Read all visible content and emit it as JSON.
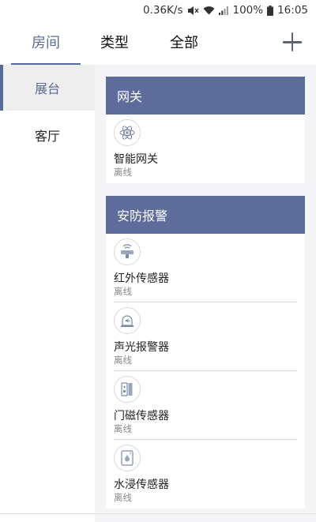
{
  "status_bar": {
    "speed": "0.36K/s",
    "battery": "100%",
    "time": "16:05",
    "icons": [
      "mute-icon",
      "wifi-icon",
      "signal-icon",
      "battery-icon"
    ]
  },
  "tabs": [
    {
      "label": "房间",
      "active": true
    },
    {
      "label": "类型",
      "active": false
    },
    {
      "label": "全部",
      "active": false
    }
  ],
  "add_icon": "plus-icon",
  "sidebar": {
    "items": [
      {
        "label": "展台",
        "active": true
      },
      {
        "label": "客厅",
        "active": false
      }
    ]
  },
  "groups": [
    {
      "title": "网关",
      "devices": [
        {
          "name": "智能网关",
          "status": "离线",
          "icon": "gateway-icon"
        }
      ]
    },
    {
      "title": "安防报警",
      "devices": [
        {
          "name": "红外传感器",
          "status": "离线",
          "icon": "infrared-sensor-icon"
        },
        {
          "name": "声光报警器",
          "status": "离线",
          "icon": "alarm-siren-icon"
        },
        {
          "name": "门磁传感器",
          "status": "离线",
          "icon": "door-sensor-icon"
        },
        {
          "name": "水浸传感器",
          "status": "离线",
          "icon": "water-sensor-icon"
        }
      ]
    }
  ],
  "colors": {
    "accent": "#5a6b9a",
    "group_header": "#5e6c9c",
    "main_bg": "#f4f4f6",
    "sidebar_active_bg": "#eeeeee",
    "status_text": "#888888"
  }
}
